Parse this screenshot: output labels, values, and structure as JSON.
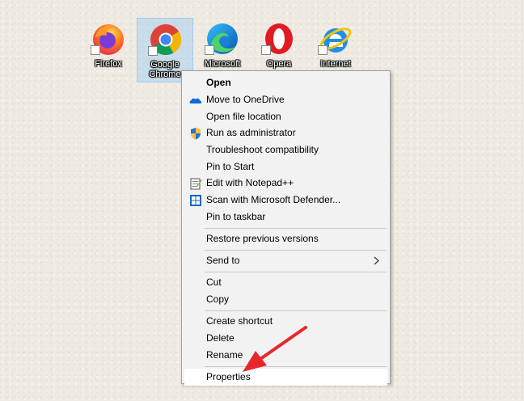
{
  "desktop": {
    "icons": [
      {
        "label": "Firefox",
        "icon": "firefox-icon"
      },
      {
        "label": "Google\nChrome",
        "icon": "chrome-icon"
      },
      {
        "label": "Microsoft",
        "icon": "edge-icon"
      },
      {
        "label": "Opera",
        "icon": "opera-icon"
      },
      {
        "label": "Internet",
        "icon": "internet-explorer-icon"
      }
    ],
    "selected_icon": "Google Chrome"
  },
  "context_menu": {
    "items": [
      {
        "label": "Open",
        "bold": true
      },
      {
        "label": "Move to OneDrive",
        "icon": "onedrive-icon"
      },
      {
        "label": "Open file location"
      },
      {
        "label": "Run as administrator",
        "icon": "uac-shield-icon"
      },
      {
        "label": "Troubleshoot compatibility"
      },
      {
        "label": "Pin to Start"
      },
      {
        "label": "Edit with Notepad++",
        "icon": "notepadpp-icon"
      },
      {
        "label": "Scan with Microsoft Defender...",
        "icon": "defender-icon"
      },
      {
        "label": "Pin to taskbar"
      },
      {
        "label": "Restore previous versions"
      },
      {
        "label": "Send to",
        "submenu": true,
        "icon": "chevron-right-icon"
      },
      {
        "label": "Cut"
      },
      {
        "label": "Copy"
      },
      {
        "label": "Create shortcut"
      },
      {
        "label": "Delete"
      },
      {
        "label": "Rename"
      },
      {
        "label": "Properties",
        "highlighted": true
      }
    ]
  },
  "annotation": {
    "icon": "red-arrow-pointer",
    "color": "#e8262b"
  },
  "colors": {
    "menu_bg": "#f2f2f2",
    "menu_hover": "#ffffff",
    "selection": "#99c9ef",
    "arrow": "#e8262b"
  }
}
